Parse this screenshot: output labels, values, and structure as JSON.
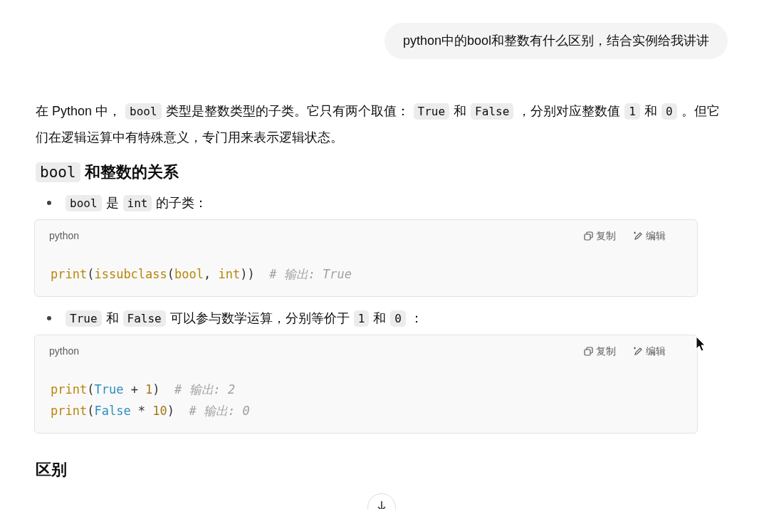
{
  "user_message": "python中的bool和整数有什么区别，结合实例给我讲讲",
  "answer": {
    "intro": [
      {
        "kind": "text",
        "text": "在 Python 中，"
      },
      {
        "kind": "code",
        "text": "bool"
      },
      {
        "kind": "text",
        "text": "类型是整数类型的子类。它只有两个取值："
      },
      {
        "kind": "code",
        "text": "True"
      },
      {
        "kind": "text",
        "text": "和"
      },
      {
        "kind": "code",
        "text": "False"
      },
      {
        "kind": "text",
        "text": "，分别对应整数值"
      },
      {
        "kind": "code",
        "text": "1"
      },
      {
        "kind": "text",
        "text": "和"
      },
      {
        "kind": "code",
        "text": "0"
      },
      {
        "kind": "text",
        "text": "。但它们在逻辑运算中有特殊意义，专门用来表示逻辑状态。"
      }
    ],
    "section_heading": [
      {
        "kind": "code",
        "text": "bool"
      },
      {
        "kind": "text",
        "text": "和整数的关系"
      }
    ],
    "bullets": [
      {
        "text": [
          {
            "kind": "code",
            "text": "bool"
          },
          {
            "kind": "text",
            "text": "是"
          },
          {
            "kind": "code",
            "text": "int"
          },
          {
            "kind": "text",
            "text": "的子类："
          }
        ],
        "code_block": {
          "language": "python",
          "copy_label": "复制",
          "edit_label": "编辑",
          "lines": [
            [
              {
                "kind": "func",
                "text": "print"
              },
              {
                "kind": "plain",
                "text": "("
              },
              {
                "kind": "func",
                "text": "issubclass"
              },
              {
                "kind": "plain",
                "text": "("
              },
              {
                "kind": "func",
                "text": "bool"
              },
              {
                "kind": "plain",
                "text": ", "
              },
              {
                "kind": "func",
                "text": "int"
              },
              {
                "kind": "plain",
                "text": "))  "
              },
              {
                "kind": "comment",
                "text": "# 输出: True"
              }
            ]
          ]
        }
      },
      {
        "text": [
          {
            "kind": "code",
            "text": "True"
          },
          {
            "kind": "text",
            "text": "和"
          },
          {
            "kind": "code",
            "text": "False"
          },
          {
            "kind": "text",
            "text": "可以参与数学运算，分别等价于"
          },
          {
            "kind": "code",
            "text": "1"
          },
          {
            "kind": "text",
            "text": "和"
          },
          {
            "kind": "code",
            "text": "0"
          },
          {
            "kind": "text",
            "text": "："
          }
        ],
        "code_block": {
          "language": "python",
          "copy_label": "复制",
          "edit_label": "编辑",
          "lines": [
            [
              {
                "kind": "func",
                "text": "print"
              },
              {
                "kind": "plain",
                "text": "("
              },
              {
                "kind": "const",
                "text": "True"
              },
              {
                "kind": "plain",
                "text": " + "
              },
              {
                "kind": "number",
                "text": "1"
              },
              {
                "kind": "plain",
                "text": ")  "
              },
              {
                "kind": "comment",
                "text": "# 输出: 2"
              }
            ],
            [
              {
                "kind": "func",
                "text": "print"
              },
              {
                "kind": "plain",
                "text": "("
              },
              {
                "kind": "const",
                "text": "False"
              },
              {
                "kind": "plain",
                "text": " * "
              },
              {
                "kind": "number",
                "text": "10"
              },
              {
                "kind": "plain",
                "text": ")  "
              },
              {
                "kind": "comment",
                "text": "# 输出: 0"
              }
            ]
          ]
        }
      }
    ],
    "next_heading": "区别"
  }
}
